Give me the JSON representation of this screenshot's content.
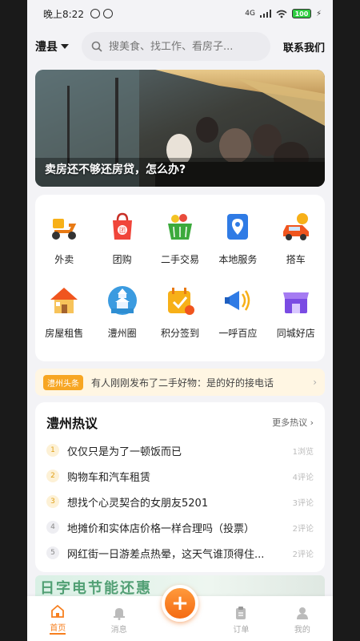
{
  "status_bar": {
    "time": "晚上8:22",
    "network": "4G",
    "battery": "100"
  },
  "header": {
    "city": "澧县",
    "search_placeholder": "搜美食、找工作、看房子...",
    "contact_label": "联系我们"
  },
  "banner": {
    "caption": "卖房还不够还房贷，怎么办?"
  },
  "services": [
    {
      "label": "外卖",
      "icon": "scooter-icon"
    },
    {
      "label": "团购",
      "icon": "shopping-bag-icon"
    },
    {
      "label": "二手交易",
      "icon": "basket-icon"
    },
    {
      "label": "本地服务",
      "icon": "location-pin-icon"
    },
    {
      "label": "搭车",
      "icon": "car-icon"
    },
    {
      "label": "房屋租售",
      "icon": "house-icon"
    },
    {
      "label": "澧州圈",
      "icon": "pagoda-icon"
    },
    {
      "label": "积分签到",
      "icon": "calendar-check-icon"
    },
    {
      "label": "一呼百应",
      "icon": "megaphone-icon"
    },
    {
      "label": "同城好店",
      "icon": "storefront-icon"
    }
  ],
  "ticker": {
    "tag": "澧州头条",
    "text": "有人刚刚发布了二手好物：是的好的接电话"
  },
  "hot": {
    "title": "澧州热议",
    "more": "更多热议",
    "items": [
      {
        "rank": "1",
        "text": "仅仅只是为了一顿饭而已",
        "stat": "1浏览"
      },
      {
        "rank": "2",
        "text": "购物车和汽车租赁",
        "stat": "4评论"
      },
      {
        "rank": "3",
        "text": "想找个心灵契合的女朋友5201",
        "stat": "3评论"
      },
      {
        "rank": "4",
        "text": "地摊价和实体店价格一样合理吗（投票）",
        "stat": "2评论"
      },
      {
        "rank": "5",
        "text": "网红街一日游差点热晕，这天气谁顶得住...",
        "stat": "2评论"
      }
    ]
  },
  "ad": {
    "text": "日字电节能还惠"
  },
  "tabbar": {
    "tabs": [
      {
        "label": "首页",
        "icon": "home-icon"
      },
      {
        "label": "消息",
        "icon": "bell-icon"
      },
      {
        "label": "订单",
        "icon": "clipboard-icon"
      },
      {
        "label": "我的",
        "icon": "person-icon"
      }
    ],
    "fab": "+"
  },
  "colors": {
    "accent": "#f77f1e",
    "tag": "#f7a623",
    "rank_top": "#f7a623"
  }
}
